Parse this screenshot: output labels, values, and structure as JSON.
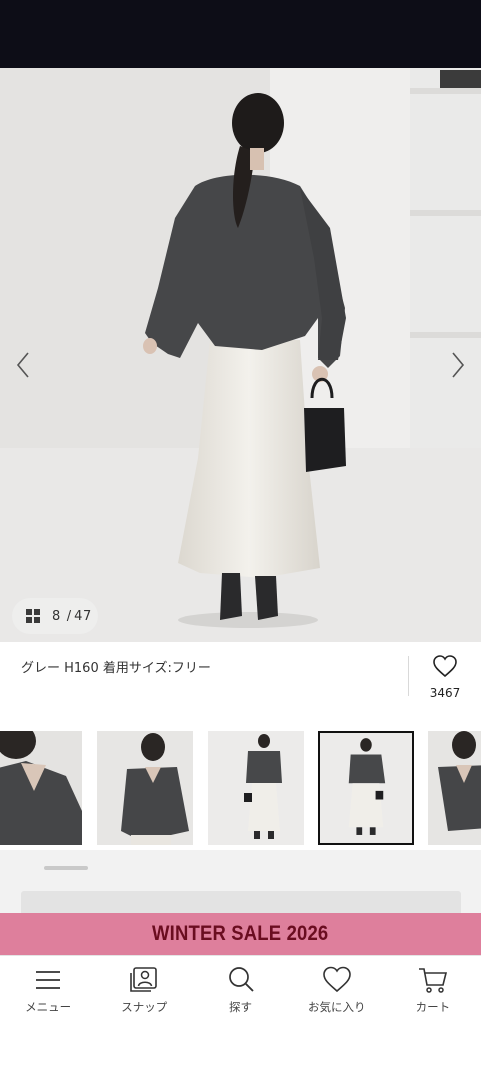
{
  "gallery": {
    "current_index": "8",
    "separator": "/",
    "total": "47"
  },
  "caption": {
    "text": "グレー H160 着用サイズ:フリー"
  },
  "favorite": {
    "count": "3467"
  },
  "thumbnails": [
    {
      "selected": false
    },
    {
      "selected": false
    },
    {
      "selected": false
    },
    {
      "selected": true
    },
    {
      "selected": false
    }
  ],
  "banner": {
    "text": "WINTER SALE 2026",
    "background_color": "#de7f9c",
    "text_color": "#6a0d20"
  },
  "bottom_nav": {
    "items": [
      {
        "label": "メニュー",
        "icon": "menu-icon"
      },
      {
        "label": "スナップ",
        "icon": "snap-icon"
      },
      {
        "label": "探す",
        "icon": "search-icon"
      },
      {
        "label": "お気に入り",
        "icon": "heart-icon"
      },
      {
        "label": "カート",
        "icon": "cart-icon"
      }
    ]
  }
}
